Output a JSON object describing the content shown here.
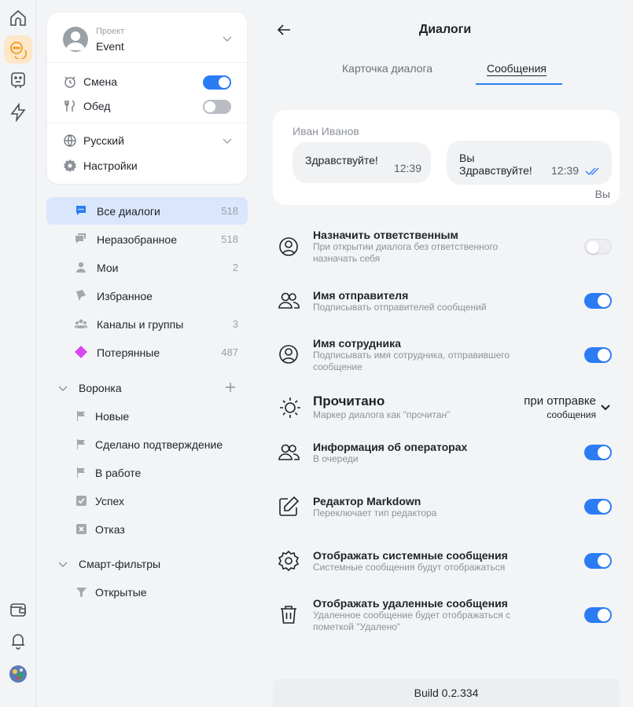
{
  "colors": {
    "accent": "#2b7cf3",
    "active_nav_bg": "#d9e6fb",
    "rail_active_bg": "#fde7c8",
    "lost_badge": "#d946ef"
  },
  "rail": {
    "top_icons": [
      "home-icon",
      "chat-icon",
      "bot-icon",
      "lightning-icon"
    ],
    "bottom_icons": [
      "wallet-icon",
      "bell-icon",
      "user-avatar"
    ]
  },
  "sidebar": {
    "project": {
      "label": "Проект",
      "value": "Event"
    },
    "toggles": [
      {
        "label": "Смена",
        "on": true
      },
      {
        "label": "Обед",
        "on": false
      }
    ],
    "language": "Русский",
    "settings": "Настройки",
    "nav": [
      {
        "label": "Все диалоги",
        "count": "518",
        "icon": "chat-bubble-icon"
      },
      {
        "label": "Неразобранное",
        "count": "518",
        "icon": "chats-icon"
      },
      {
        "label": "Мои",
        "count": "2",
        "icon": "person-icon"
      },
      {
        "label": "Избранное",
        "count": "",
        "icon": "bookmark-icon"
      },
      {
        "label": "Каналы и группы",
        "count": "3",
        "icon": "group-icon"
      },
      {
        "label": "Потерянные",
        "count": "487",
        "icon": "diamond-icon"
      }
    ],
    "funnel": {
      "label": "Воронка",
      "items": [
        "Новые",
        "Сделано подтверждение",
        "В работе",
        "Успех",
        "Отказ"
      ]
    },
    "smart": {
      "label": "Смарт-фильтры",
      "items": [
        "Открытые"
      ]
    }
  },
  "main": {
    "title": "Диалоги",
    "tabs": [
      {
        "label": "Карточка диалога",
        "active": false
      },
      {
        "label": "Сообщения",
        "active": true
      }
    ],
    "preview": {
      "sender": "Иван Иванов",
      "incoming": {
        "text": "Здравствуйте!",
        "time": "12:39"
      },
      "outgoing": {
        "line1": "Вы",
        "line2": "Здравствуйте!",
        "time": "12:39"
      },
      "you_label": "Вы"
    },
    "settings": [
      {
        "title": "Назначить ответственным",
        "desc": "При открытии диалога без ответственного назначать себя",
        "on": false,
        "icon": "user-circle-icon"
      },
      {
        "title": "Имя отправителя",
        "desc": "Подписывать отправителей сообщений",
        "on": true,
        "icon": "users-icon"
      },
      {
        "title": "Имя сотрудника",
        "desc": "Подписывать имя сотрудника, отправившего сообщение",
        "on": true,
        "icon": "user-circle-icon"
      },
      {
        "title": "Информация об операторах",
        "desc": "В очереди",
        "on": true,
        "icon": "users-icon"
      },
      {
        "title": "Редактор Markdown",
        "desc": "Переключает тип редактора",
        "on": true,
        "icon": "edit-icon"
      },
      {
        "title": "Отображать системные сообщения",
        "desc": "Системные сообщения будут отображаться",
        "on": true,
        "icon": "gear-icon"
      },
      {
        "title": "Отображать удаленные сообщения",
        "desc": "Удаленное сообщение будет отображаться с пометкой \"Удалено\"",
        "on": true,
        "icon": "trash-icon"
      }
    ],
    "read_marker": {
      "title": "Прочитано",
      "desc": "Маркер диалога как \"прочитан\"",
      "value_line1": "при отправке",
      "value_line2": "сообщения"
    },
    "build": "Build 0.2.334"
  }
}
